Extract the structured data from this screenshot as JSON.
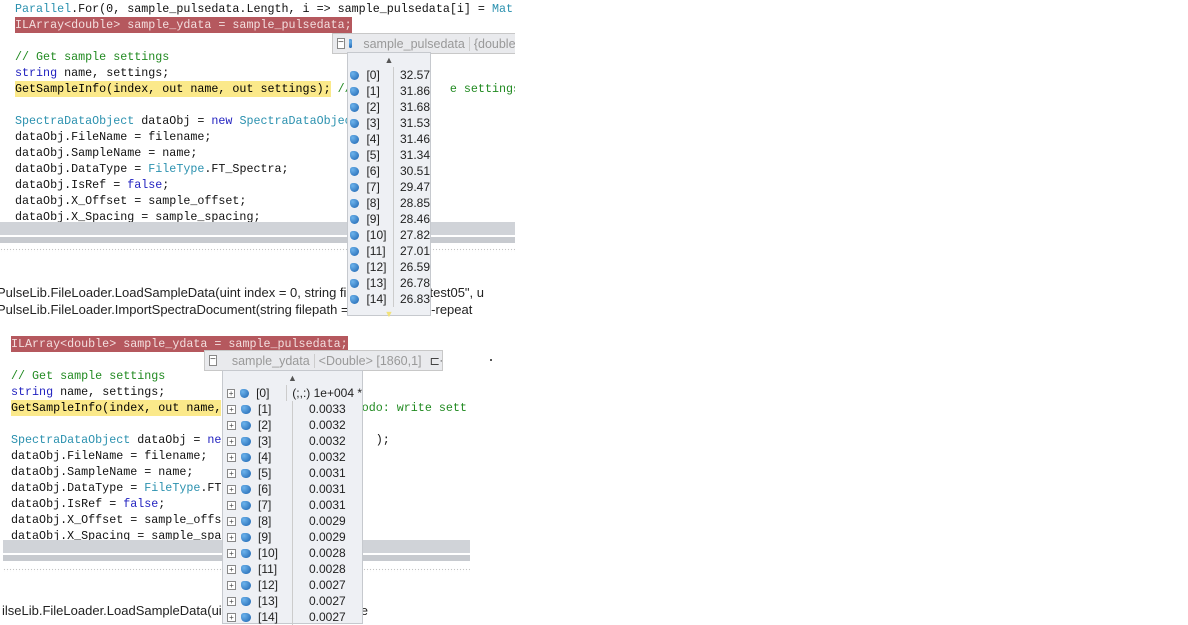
{
  "top": {
    "code": [
      [
        {
          "t": "Parallel",
          "c": "ty"
        },
        {
          "t": ".For(0, sample_pulsedata.Length, i => sample_pulsedata[i] = ",
          "c": "tx"
        },
        {
          "t": "Mat",
          "c": "ty"
        }
      ],
      [
        {
          "t": "ILArray<double> sample_ydata = sample_pulsedata;",
          "c": "hl-red"
        }
      ],
      [],
      [
        {
          "t": "// Get sample settings",
          "c": "cm"
        }
      ],
      [
        {
          "t": "string",
          "c": "kw"
        },
        {
          "t": " name, settings;",
          "c": "tx"
        }
      ],
      [
        {
          "t": "GetSampleInfo(index, out name, out settings);",
          "c": "hl-yel"
        },
        {
          "t": " //",
          "c": "cm"
        },
        {
          "t": "              ",
          "c": "tx"
        },
        {
          "t": "e settings a",
          "c": "cm"
        }
      ],
      [],
      [
        {
          "t": "SpectraDataObject",
          "c": "ty"
        },
        {
          "t": " dataObj = ",
          "c": "tx"
        },
        {
          "t": "new",
          "c": "kw"
        },
        {
          "t": " ",
          "c": "tx"
        },
        {
          "t": "SpectraDataObjec",
          "c": "ty"
        }
      ],
      [
        {
          "t": "dataObj.FileName = filename;",
          "c": "tx"
        }
      ],
      [
        {
          "t": "dataObj.SampleName = name;",
          "c": "tx"
        }
      ],
      [
        {
          "t": "dataObj.DataType = ",
          "c": "tx"
        },
        {
          "t": "FileType",
          "c": "ty"
        },
        {
          "t": ".FT_Spectra;",
          "c": "tx"
        }
      ],
      [
        {
          "t": "dataObj.IsRef = ",
          "c": "tx"
        },
        {
          "t": "false",
          "c": "kw"
        },
        {
          "t": ";",
          "c": "tx"
        }
      ],
      [
        {
          "t": "dataObj.X_Offset = sample_offset;",
          "c": "tx"
        }
      ],
      [
        {
          "t": "dataObj.X_Spacing = sample_spacing;",
          "c": "tx"
        }
      ]
    ],
    "call_stack": [
      "PulseLib.FileLoader.LoadSampleData(uint index = 0, string filename                                ability test05\", u",
      "PulseLib.FileLoader.ImportSpectraDocument(string filepath = \"C:\\\\                                les\\\\NTU-repeat"
    ],
    "tooltip": {
      "name": "sample_pulsedata",
      "type": "{double[",
      "items": [
        {
          "index": "[0]",
          "value": "32.57"
        },
        {
          "index": "[1]",
          "value": "31.86"
        },
        {
          "index": "[2]",
          "value": "31.68"
        },
        {
          "index": "[3]",
          "value": "31.53"
        },
        {
          "index": "[4]",
          "value": "31.46"
        },
        {
          "index": "[5]",
          "value": "31.34"
        },
        {
          "index": "[6]",
          "value": "30.51"
        },
        {
          "index": "[7]",
          "value": "29.47"
        },
        {
          "index": "[8]",
          "value": "28.85"
        },
        {
          "index": "[9]",
          "value": "28.46"
        },
        {
          "index": "[10]",
          "value": "27.82"
        },
        {
          "index": "[11]",
          "value": "27.01"
        },
        {
          "index": "[12]",
          "value": "26.59"
        },
        {
          "index": "[13]",
          "value": "26.78"
        },
        {
          "index": "[14]",
          "value": "26.83"
        }
      ]
    }
  },
  "bottom": {
    "code": [
      [
        {
          "t": "ILArray<double> sample_ydata = sample_pulsedata;",
          "c": "hl-red"
        }
      ],
      [],
      [
        {
          "t": "// Get sample settings",
          "c": "cm"
        }
      ],
      [
        {
          "t": "string",
          "c": "kw"
        },
        {
          "t": " name, settings;",
          "c": "tx"
        }
      ],
      [
        {
          "t": "GetSampleInfo(index, out name,",
          "c": "hl-yel"
        },
        {
          "t": "                    ",
          "c": "tx"
        },
        {
          "t": "odo: write sett",
          "c": "cm"
        }
      ],
      [],
      [
        {
          "t": "SpectraDataObject",
          "c": "ty"
        },
        {
          "t": " dataObj = ",
          "c": "tx"
        },
        {
          "t": "ne",
          "c": "kw"
        },
        {
          "t": "                      );",
          "c": "tx"
        }
      ],
      [
        {
          "t": "dataObj.FileName = filename;",
          "c": "tx"
        }
      ],
      [
        {
          "t": "dataObj.SampleName = name;",
          "c": "tx"
        }
      ],
      [
        {
          "t": "dataObj.DataType = ",
          "c": "tx"
        },
        {
          "t": "FileType",
          "c": "ty"
        },
        {
          "t": ".FT",
          "c": "tx"
        }
      ],
      [
        {
          "t": "dataObj.IsRef = ",
          "c": "tx"
        },
        {
          "t": "false",
          "c": "kw"
        },
        {
          "t": ";",
          "c": "tx"
        }
      ],
      [
        {
          "t": "dataObj.X_Offset = sample_offs",
          "c": "tx"
        }
      ],
      [
        {
          "t": "dataObj.X_Spacing = sample_spa",
          "c": "tx"
        }
      ]
    ],
    "call_stack": [
      "ilseLib.FileLoader.LoadSampleData(uint in                             'NTU-repeatability te"
    ],
    "tooltip": {
      "name": "sample_ydata",
      "type": "<Double> [1860,1]",
      "items": [
        {
          "index": "[0]",
          "value": "(;,:) 1e+004 *"
        },
        {
          "index": "[1]",
          "value": "0.0033"
        },
        {
          "index": "[2]",
          "value": "0.0032"
        },
        {
          "index": "[3]",
          "value": "0.0032"
        },
        {
          "index": "[4]",
          "value": "0.0032"
        },
        {
          "index": "[5]",
          "value": "0.0031"
        },
        {
          "index": "[6]",
          "value": "0.0031"
        },
        {
          "index": "[7]",
          "value": "0.0031"
        },
        {
          "index": "[8]",
          "value": "0.0029"
        },
        {
          "index": "[9]",
          "value": "0.0029"
        },
        {
          "index": "[10]",
          "value": "0.0028"
        },
        {
          "index": "[11]",
          "value": "0.0028"
        },
        {
          "index": "[12]",
          "value": "0.0027"
        },
        {
          "index": "[13]",
          "value": "0.0027"
        },
        {
          "index": "[14]",
          "value": "0.0027"
        }
      ]
    }
  }
}
